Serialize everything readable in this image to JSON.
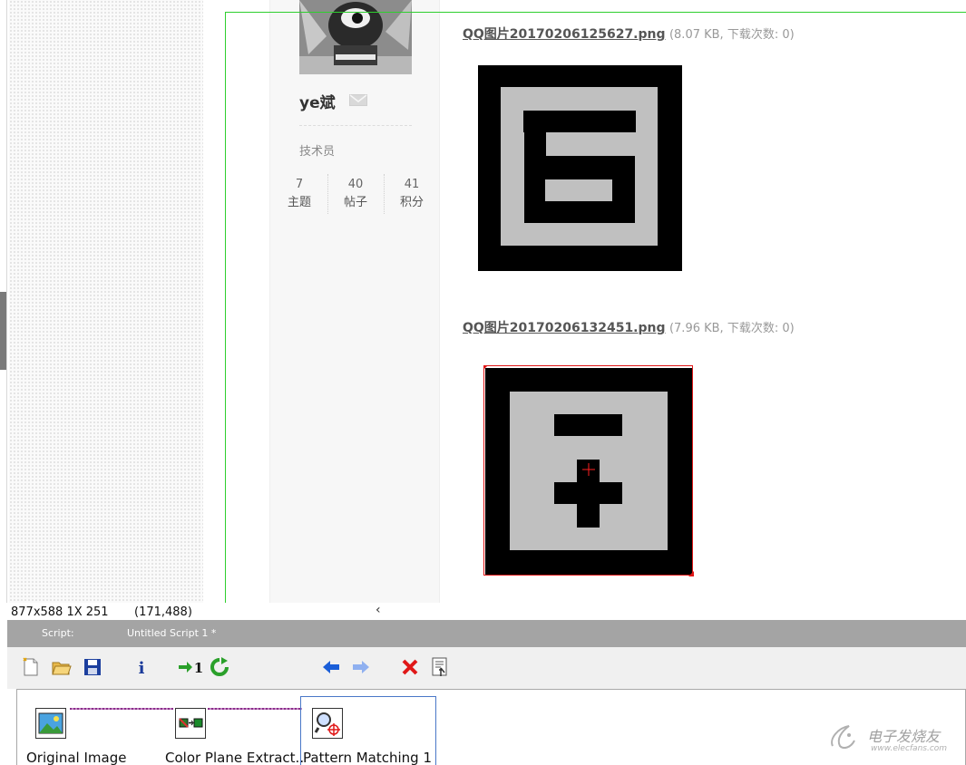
{
  "profile": {
    "username": "ye斌",
    "role": "技术员",
    "stats": [
      {
        "value": "7",
        "label": "主题"
      },
      {
        "value": "40",
        "label": "帖子"
      },
      {
        "value": "41",
        "label": "积分"
      }
    ]
  },
  "attachments": [
    {
      "filename": "QQ图片20170206125627.png",
      "meta": "(8.07 KB, 下载次数: 0)"
    },
    {
      "filename": "QQ图片20170206132451.png",
      "meta": "(7.96 KB, 下载次数: 0)"
    }
  ],
  "status": {
    "dimensions": "877x588 1X 251",
    "coordinates": "(171,488)",
    "collapse_glyph": "‹"
  },
  "script_panel": {
    "label": "Script:",
    "name": "Untitled Script 1 *"
  },
  "toolbar_icons": [
    "new-script-icon",
    "open-script-icon",
    "save-script-icon",
    "info-icon",
    "run-once-icon",
    "run-continuous-icon",
    "step-back-icon",
    "step-forward-icon",
    "delete-step-icon",
    "properties-icon"
  ],
  "steps": [
    {
      "label": "Original Image"
    },
    {
      "label": "Color Plane Extract.."
    },
    {
      "label": "Pattern Matching 1"
    }
  ],
  "colors": {
    "roi_line": "#2ecf2e",
    "match_box": "#e01818",
    "connector": "#8a2c8a",
    "selected_step_border": "#4a78c8"
  },
  "watermark": {
    "main": "电子发烧友",
    "url": "www.elecfans.com"
  }
}
